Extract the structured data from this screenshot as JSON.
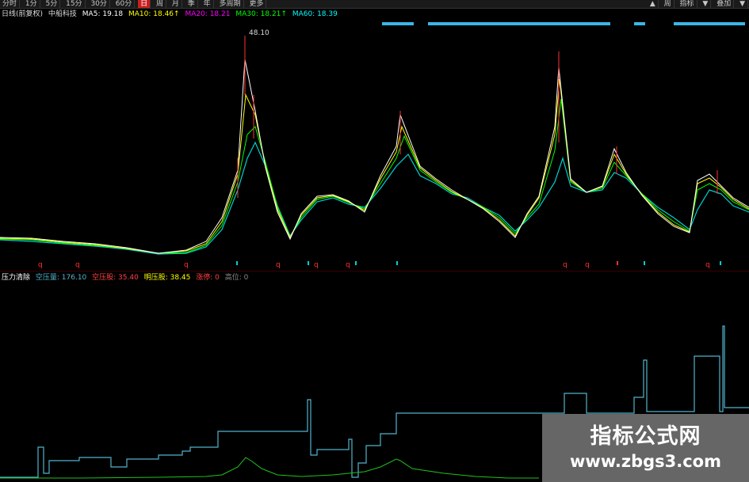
{
  "toolbar": {
    "items": [
      "分时",
      "1分",
      "5分",
      "15分",
      "30分",
      "60分",
      "日",
      "周",
      "月",
      "季",
      "年",
      "多周期",
      "更多"
    ],
    "active_index": 6,
    "right_items": [
      "▲",
      "周",
      "指标",
      "▼",
      "叠加",
      "▼"
    ]
  },
  "legend_top": {
    "period": "日线(前复权)",
    "name": "中船科技",
    "ma5": "MA5: 19.18",
    "ma10": "MA10: 18.46↑",
    "ma20": "MA20: 18.21",
    "ma30": "MA30: 18.21↑",
    "ma60": "MA60: 18.39"
  },
  "peak_label": "48.10",
  "legend_bottom": {
    "name": "压力清除",
    "a": "空压量: 176.10",
    "b": "空压股: 35.40",
    "c": "明压股: 38.45",
    "d": "涨停: 0",
    "e": "高位: 0"
  },
  "colors": {
    "ma5": "#ffffff",
    "ma10": "#ffff00",
    "ma20": "#ff00ff",
    "ma30": "#00ff00",
    "ma60": "#00ffff",
    "kline_up": "#ff3030",
    "kline_down": "#00d0d0"
  },
  "watermark": {
    "line1": "指标公式网",
    "line2": "www.zbgs3.com"
  }
}
